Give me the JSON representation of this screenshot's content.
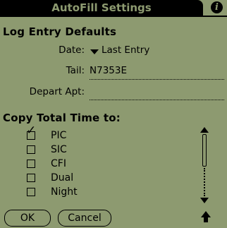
{
  "title": "AutoFill Settings",
  "info_icon": "i",
  "log_entry": {
    "heading": "Log Entry Defaults",
    "date_label": "Date:",
    "date_value": "Last Entry",
    "tail_label": "Tail:",
    "tail_value": "N7353E",
    "depart_label": "Depart Apt:",
    "depart_value": ""
  },
  "copy_total": {
    "heading": "Copy Total Time to:",
    "items": [
      {
        "label": "PIC",
        "checked": true
      },
      {
        "label": "SIC",
        "checked": false
      },
      {
        "label": "CFI",
        "checked": false
      },
      {
        "label": "Dual",
        "checked": false
      },
      {
        "label": "Night",
        "checked": false
      }
    ]
  },
  "buttons": {
    "ok": "OK",
    "cancel": "Cancel"
  },
  "colors": {
    "background": "#8d9a70",
    "foreground": "#000000"
  }
}
